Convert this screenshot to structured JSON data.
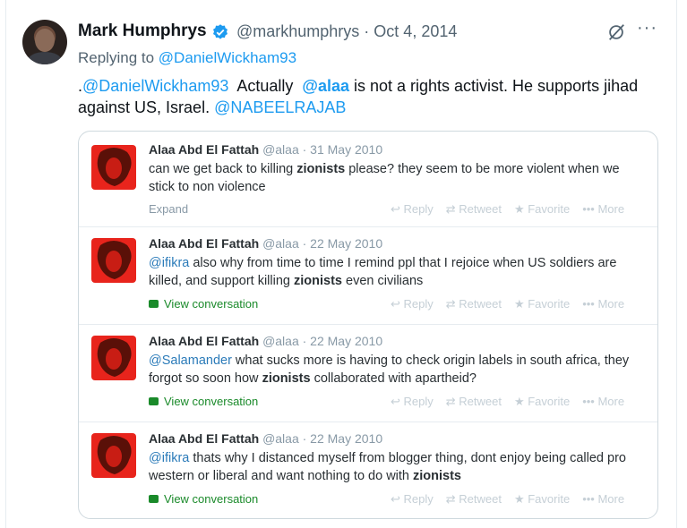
{
  "tweet": {
    "author_name": "Mark Humphrys",
    "handle_date": "@markhumphrys · Oct 4, 2014",
    "replying_prefix": "Replying to",
    "replying_to": "@DanielWickham93",
    "text_parts": {
      "p1": ".",
      "m1": "@DanielWickham93",
      "p2": "  Actually  ",
      "m2": "@alaa",
      "p3": " is not a rights activist. He supports jihad against US, Israel.  ",
      "m3": "@NABEELRAJAB"
    },
    "more_label": "···"
  },
  "embed": {
    "items": [
      {
        "name": "Alaa Abd El Fattah",
        "meta": "@alaa · 31 May 2010",
        "mention": "",
        "text_a": "can we get back to killing ",
        "bold": "zionists",
        "text_b": " please? they seem to be more violent when we stick to non violence",
        "footer": "Expand"
      },
      {
        "name": "Alaa Abd El Fattah",
        "meta": "@alaa · 22 May 2010",
        "mention": "@ifikra",
        "text_a": " also why from time to time I remind ppl that I rejoice when US soldiers are killed, and support killing ",
        "bold": "zionists",
        "text_b": " even civilians",
        "footer": "View conversation"
      },
      {
        "name": "Alaa Abd El Fattah",
        "meta": "@alaa · 22 May 2010",
        "mention": "@Salamander",
        "text_a": " what sucks more is having to check origin labels in south africa, they forgot so soon how ",
        "bold": "zionists",
        "text_b": " collaborated with apartheid?",
        "footer": "View conversation"
      },
      {
        "name": "Alaa Abd El Fattah",
        "meta": "@alaa · 22 May 2010",
        "mention": "@ifikra",
        "text_a": " thats why I distanced myself from blogger thing, dont enjoy being called pro western or liberal and want nothing to do with ",
        "bold": "zionists",
        "text_b": "",
        "footer": "View conversation"
      }
    ],
    "actions": {
      "reply": "↩ Reply",
      "retweet": "⇄ Retweet",
      "favorite": "★ Favorite",
      "more": "••• More"
    }
  },
  "colors": {
    "link": "#1d9bf0",
    "thumb_bg": "#e8241c",
    "view_conversation": "#1a8a2a"
  },
  "icons": [
    "verified-badge-icon",
    "grok-icon",
    "more-icon",
    "reply-icon",
    "retweet-icon",
    "favorite-icon",
    "conversation-bubble-icon"
  ]
}
